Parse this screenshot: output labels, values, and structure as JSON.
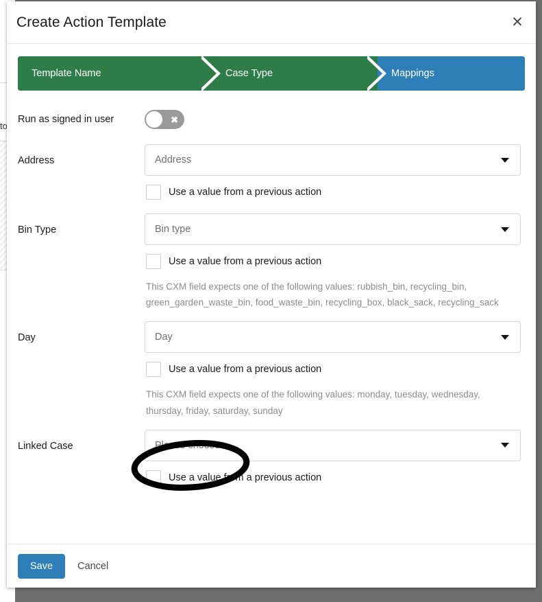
{
  "window": {
    "backdrop_color": "#6e6e6e",
    "background_fragment_text": "to"
  },
  "modal": {
    "title": "Create Action Template",
    "close_icon": "close-icon",
    "close_glyph": "✕"
  },
  "stepper": {
    "completed_color": "#2e7d48",
    "active_color": "#2e7eb8",
    "steps": [
      {
        "label": "Template Name",
        "state": "completed"
      },
      {
        "label": "Case Type",
        "state": "completed"
      },
      {
        "label": "Mappings",
        "state": "active"
      }
    ]
  },
  "run_as": {
    "label": "Run as signed in user",
    "state": "off",
    "glyph": "✖"
  },
  "fields": [
    {
      "label": "Address",
      "select_value": "Address",
      "caret_icon": "chevron-down-icon",
      "checkbox_label": "Use a value from a previous action",
      "checkbox_checked": false,
      "helper": ""
    },
    {
      "label": "Bin Type",
      "select_value": "Bin type",
      "caret_icon": "chevron-down-icon",
      "checkbox_label": "Use a value from a previous action",
      "checkbox_checked": false,
      "helper": "This CXM field expects one of the following values: rubbish_bin, recycling_bin, green_garden_waste_bin, food_waste_bin, recycling_box, black_sack, recycling_sack"
    },
    {
      "label": "Day",
      "select_value": "Day",
      "caret_icon": "chevron-down-icon",
      "checkbox_label": "Use a value from a previous action",
      "checkbox_checked": false,
      "helper": "This CXM field expects one of the following values: monday, tuesday, wednesday, thursday, friday, saturday, sunday"
    },
    {
      "label": "Linked Case",
      "select_value": "Please choose...",
      "caret_icon": "chevron-down-icon",
      "checkbox_label": "Use a value from a previous action",
      "checkbox_checked": false,
      "helper": "",
      "annotated": true
    }
  ],
  "annotation": {
    "shape": "ellipse",
    "color": "#000000",
    "targets": "Please choose... select"
  },
  "footer": {
    "save_label": "Save",
    "cancel_label": "Cancel",
    "save_color": "#2e7eb8"
  }
}
